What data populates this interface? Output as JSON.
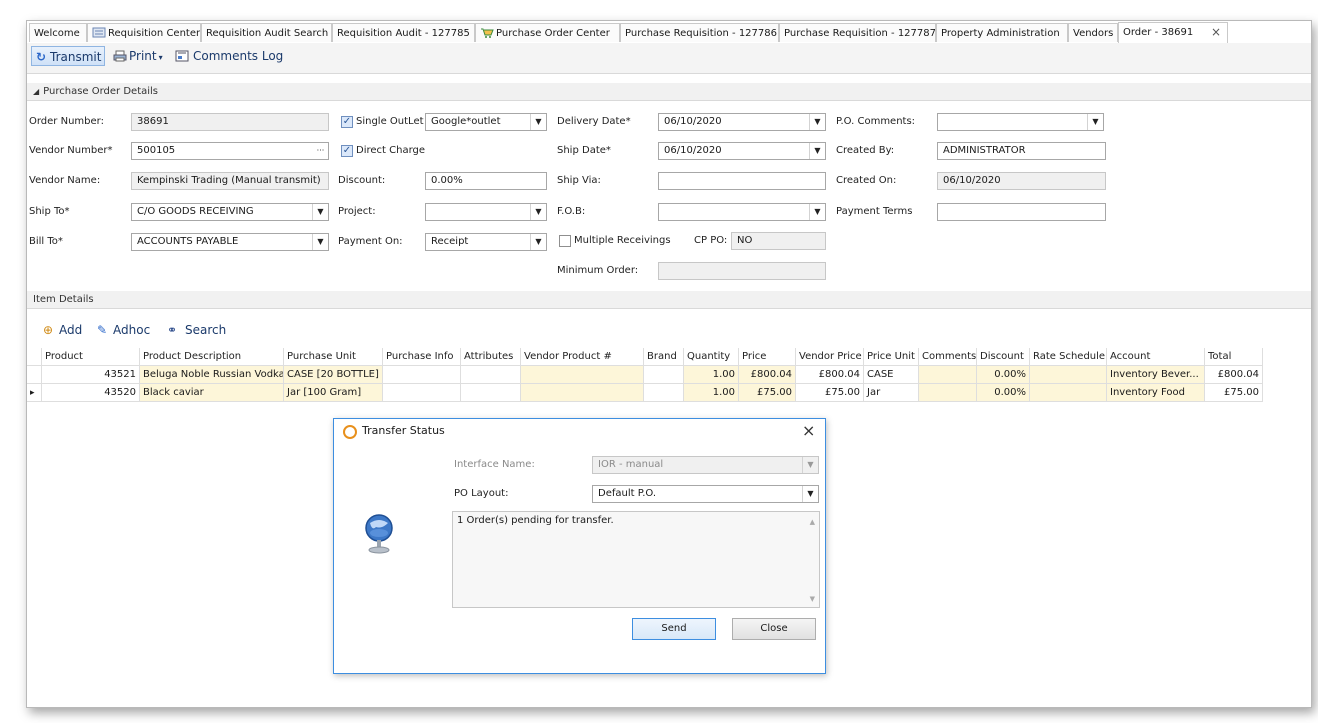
{
  "tabs": [
    {
      "label": "Welcome",
      "active": false
    },
    {
      "label": "Requisition Center",
      "active": false
    },
    {
      "label": "Requisition Audit Search",
      "active": false
    },
    {
      "label": "Requisition Audit - 127785",
      "active": false
    },
    {
      "label": "Purchase Order Center",
      "active": false
    },
    {
      "label": "Purchase Requisition - 127786",
      "active": false
    },
    {
      "label": "Purchase Requisition - 127787",
      "active": false
    },
    {
      "label": "Property Administration",
      "active": false
    },
    {
      "label": "Vendors",
      "active": false
    },
    {
      "label": "Order - 38691",
      "active": true
    }
  ],
  "tab_close": "×",
  "toolbar": {
    "transmit": "Transmit",
    "print": "Print",
    "comments_log": "Comments Log"
  },
  "po_details": {
    "section_title": "Purchase Order Details",
    "order_number_label": "Order Number:",
    "order_number": "38691",
    "vendor_number_label": "Vendor Number*",
    "vendor_number": "500105",
    "vendor_name_label": "Vendor Name:",
    "vendor_name": "Kempinski Trading (Manual transmit)",
    "ship_to_label": "Ship To*",
    "ship_to": "C/O GOODS RECEIVING",
    "bill_to_label": "Bill To*",
    "bill_to": "ACCOUNTS PAYABLE",
    "single_outlet_label": "Single OutLet",
    "single_outlet_checked": true,
    "outlet": "Google*outlet",
    "direct_charge_label": "Direct Charge",
    "direct_charge_checked": true,
    "discount_label": "Discount:",
    "discount": "0.00%",
    "project_label": "Project:",
    "project": "",
    "payment_on_label": "Payment On:",
    "payment_on": "Receipt",
    "delivery_date_label": "Delivery Date*",
    "delivery_date": "06/10/2020",
    "ship_date_label": "Ship Date*",
    "ship_date": "06/10/2020",
    "ship_via_label": "Ship Via:",
    "ship_via": "",
    "fob_label": "F.O.B:",
    "fob": "",
    "multiple_receivings_label": "Multiple Receivings",
    "multiple_receivings_checked": false,
    "cp_po_label": "CP PO:",
    "cp_po": "NO",
    "minimum_order_label": "Minimum Order:",
    "minimum_order": "",
    "po_comments_label": "P.O. Comments:",
    "po_comments": "",
    "created_by_label": "Created By:",
    "created_by": "ADMINISTRATOR",
    "created_on_label": "Created On:",
    "created_on": "06/10/2020",
    "payment_terms_label": "Payment Terms",
    "payment_terms": ""
  },
  "item_details": {
    "section_title": "Item Details",
    "add": "Add",
    "adhoc": "Adhoc",
    "search": "Search",
    "columns": [
      "Product",
      "Product Description",
      "Purchase Unit",
      "Purchase Info",
      "Attributes",
      "Vendor Product #",
      "Brand",
      "Quantity",
      "Price",
      "Vendor Price",
      "Price Unit",
      "Comments",
      "Discount",
      "Rate Schedule",
      "Account",
      "Total"
    ],
    "rows": [
      {
        "indicator": "",
        "product": "43521",
        "description": "Beluga Noble Russian Vodka",
        "purchase_unit": "CASE [20 BOTTLE]",
        "purchase_info": "",
        "attributes": "",
        "vendor_product": "",
        "brand": "",
        "quantity": "1.00",
        "price": "£800.04",
        "vendor_price": "£800.04",
        "price_unit": "CASE",
        "comments": "",
        "discount": "0.00%",
        "rate_schedule": "",
        "account": "Inventory Bever...",
        "total": "£800.04"
      },
      {
        "indicator": "▸",
        "product": "43520",
        "description": "Black caviar",
        "purchase_unit": "Jar [100 Gram]",
        "purchase_info": "",
        "attributes": "",
        "vendor_product": "",
        "brand": "",
        "quantity": "1.00",
        "price": "£75.00",
        "vendor_price": "£75.00",
        "price_unit": "Jar",
        "comments": "",
        "discount": "0.00%",
        "rate_schedule": "",
        "account": "Inventory Food",
        "total": "£75.00"
      }
    ]
  },
  "dialog": {
    "title": "Transfer Status",
    "interface_name_label": "Interface Name:",
    "interface_name": "IOR - manual",
    "po_layout_label": "PO Layout:",
    "po_layout": "Default P.O.",
    "message": "1 Order(s) pending for transfer.",
    "send": "Send",
    "close": "Close",
    "close_x": "×"
  }
}
